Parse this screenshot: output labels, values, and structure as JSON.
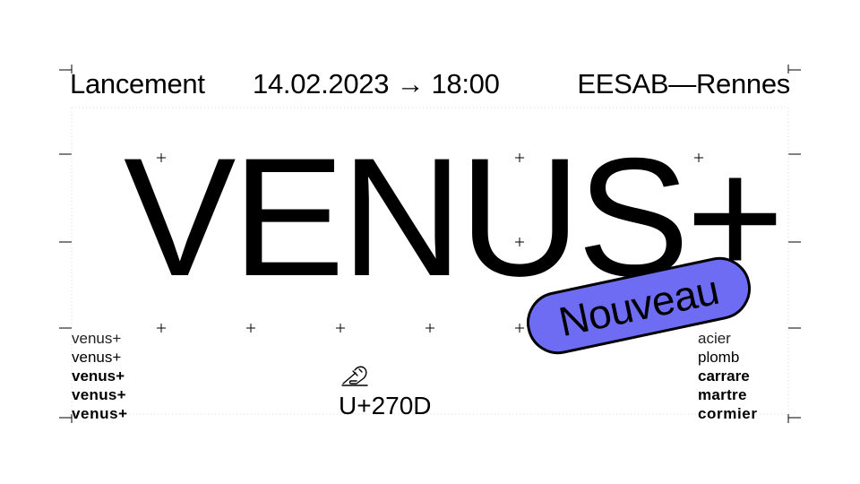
{
  "header": {
    "event": "Lancement",
    "datetime": "14.02.2023 → 18:00",
    "venue": "EESAB—Rennes"
  },
  "headline": "VENUS+",
  "badge": {
    "label": "Nouveau",
    "color": "#6e6cf2"
  },
  "weights_left": [
    "venus+",
    "venus+",
    "venus+",
    "venus+",
    "venus+"
  ],
  "weights_right": [
    "acier",
    "plomb",
    "carrare",
    "martre",
    "cormier"
  ],
  "glyph": {
    "icon": "writing-hand-icon",
    "codepoint": "U+270D"
  }
}
